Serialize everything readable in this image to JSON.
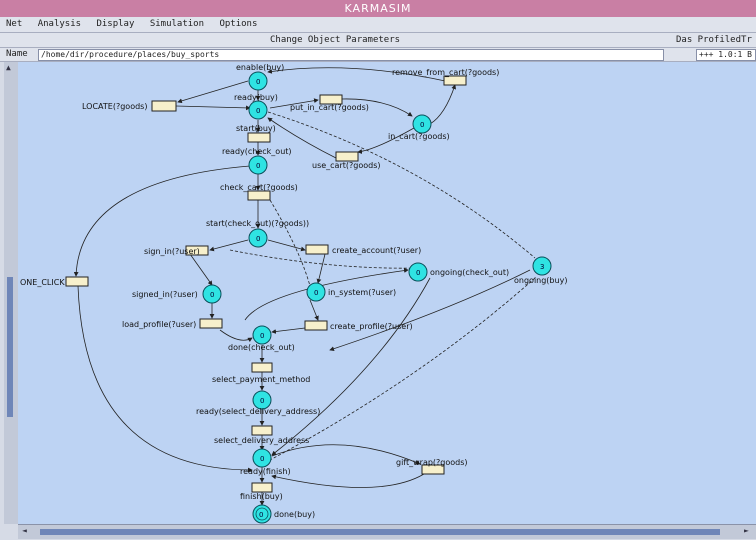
{
  "window": {
    "title": "KARMASIM"
  },
  "menu": [
    "Net",
    "Analysis",
    "Display",
    "Simulation",
    "Options"
  ],
  "toolbar": {
    "center": "Change Object Parameters",
    "right": "Das ProfiledTr"
  },
  "path": {
    "label": "Name",
    "value": "/home/dir/procedure/places/buy_sports",
    "zoom": "+++ 1.0:1 B"
  },
  "places": [
    {
      "id": "p_enable",
      "label": "enable(buy)",
      "token": "0"
    },
    {
      "id": "p_ready",
      "label": "ready(buy)",
      "token": "0"
    },
    {
      "id": "p_incart",
      "label": "in_cart(?goods)",
      "token": "0"
    },
    {
      "id": "p_readycheck",
      "label": "ready(check_out)",
      "token": "0"
    },
    {
      "id": "p_startcheck",
      "label": "start(check_out)(?goods))",
      "token": "0"
    },
    {
      "id": "p_ongoingcheck",
      "label": "ongoing(check_out)",
      "token": "0"
    },
    {
      "id": "p_ongoingbuy",
      "label": "ongoing(buy)",
      "token": "3"
    },
    {
      "id": "p_signedin",
      "label": "signed_in(?user)",
      "token": "0"
    },
    {
      "id": "p_insystem",
      "label": "in_system(?user)",
      "token": "0"
    },
    {
      "id": "p_donecheck",
      "label": "done(check_out)",
      "token": "0"
    },
    {
      "id": "p_readydelivery",
      "label": "ready(select_delivery_address)",
      "token": "0"
    },
    {
      "id": "p_readyfinish",
      "label": "ready(finish)",
      "token": "0"
    },
    {
      "id": "p_donebuy",
      "label": "done(buy)",
      "token": "0"
    }
  ],
  "transitions": [
    {
      "id": "t_locate",
      "label": "LOCATE(?goods)"
    },
    {
      "id": "t_putincart",
      "label": "put_in_cart(?goods)"
    },
    {
      "id": "t_remove",
      "label": "remove_from_cart(?goods)"
    },
    {
      "id": "t_startbuy",
      "label": "start(buy)"
    },
    {
      "id": "t_usecart",
      "label": "use_cart(?goods)"
    },
    {
      "id": "t_checkcart",
      "label": "check_cart(?goods)"
    },
    {
      "id": "t_signin",
      "label": "sign_in(?user)"
    },
    {
      "id": "t_createaccount",
      "label": "create_account(?user)"
    },
    {
      "id": "t_oneclick",
      "label": "ONE_CLICK"
    },
    {
      "id": "t_loadprofile",
      "label": "load_profile(?user)"
    },
    {
      "id": "t_createprofile",
      "label": "create_profile(?user)"
    },
    {
      "id": "t_selectpayment",
      "label": "select_payment_method"
    },
    {
      "id": "t_selectdelivery",
      "label": "select_delivery_address"
    },
    {
      "id": "t_giftwrap",
      "label": "gift_wrap(?goods)"
    },
    {
      "id": "t_finish",
      "label": "finish(buy)"
    }
  ],
  "colors": {
    "canvas": "#bdd3f3",
    "place": "#2fe3e3",
    "transition": "#f7f0cc",
    "title_bar": "#c97fa4"
  }
}
